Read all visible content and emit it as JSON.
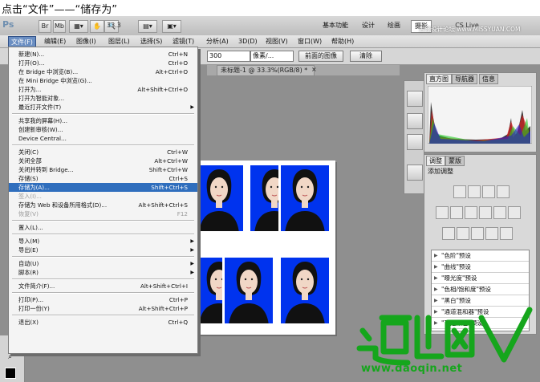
{
  "caption": "点击“文件”——“储存为”",
  "topbar": {
    "zoom": "33.3",
    "workspaces": [
      "基本功能",
      "设计",
      "绘画",
      "摄影"
    ],
    "cs_live": "CS Live",
    "overlay_text": "思缘设计论坛 www.MISSYUAN.COM"
  },
  "menubar": [
    "文件(F)",
    "编辑(E)",
    "图像(I)",
    "图层(L)",
    "选择(S)",
    "滤镜(T)",
    "分析(A)",
    "3D(D)",
    "视图(V)",
    "窗口(W)",
    "帮助(H)"
  ],
  "optbar": {
    "resolution_value": "300",
    "unit": "像素/...",
    "front_image_button": "前面的图像",
    "clear_button": "清除"
  },
  "tabs": {
    "doc_tab_label": "未标题-1 @ 33.3%(RGB/8) *"
  },
  "file_menu": [
    {
      "label": "新建(N)...",
      "shortcut": "Ctrl+N"
    },
    {
      "label": "打开(O)...",
      "shortcut": "Ctrl+O"
    },
    {
      "label": "在 Bridge 中浏览(B)...",
      "shortcut": "Alt+Ctrl+O"
    },
    {
      "label": "在 Mini Bridge 中浏览(G)...",
      "shortcut": ""
    },
    {
      "label": "打开为...",
      "shortcut": "Alt+Shift+Ctrl+O"
    },
    {
      "label": "打开为智能对象...",
      "shortcut": ""
    },
    {
      "label": "最近打开文件(T)",
      "shortcut": ""
    },
    {
      "label": "共享我的屏幕(H)...",
      "shortcut": ""
    },
    {
      "label": "创建新审核(W)...",
      "shortcut": ""
    },
    {
      "label": "Device Central...",
      "shortcut": ""
    },
    {
      "label": "关闭(C)",
      "shortcut": "Ctrl+W"
    },
    {
      "label": "关闭全部",
      "shortcut": "Alt+Ctrl+W"
    },
    {
      "label": "关闭并转到 Bridge...",
      "shortcut": "Shift+Ctrl+W"
    },
    {
      "label": "存储(S)",
      "shortcut": "Ctrl+S"
    },
    {
      "label": "存储为(A)...",
      "shortcut": "Shift+Ctrl+S"
    },
    {
      "label": "签入(I)...",
      "shortcut": ""
    },
    {
      "label": "存储为 Web 和设备所用格式(D)...",
      "shortcut": "Alt+Shift+Ctrl+S"
    },
    {
      "label": "恢复(V)",
      "shortcut": "F12"
    },
    {
      "label": "置入(L)...",
      "shortcut": ""
    },
    {
      "label": "导入(M)",
      "shortcut": ""
    },
    {
      "label": "导出(E)",
      "shortcut": ""
    },
    {
      "label": "自动(U)",
      "shortcut": ""
    },
    {
      "label": "脚本(R)",
      "shortcut": ""
    },
    {
      "label": "文件简介(F)...",
      "shortcut": "Alt+Shift+Ctrl+I"
    },
    {
      "label": "打印(P)...",
      "shortcut": "Ctrl+P"
    },
    {
      "label": "打印一份(Y)",
      "shortcut": "Alt+Shift+Ctrl+P"
    },
    {
      "label": "退出(X)",
      "shortcut": "Ctrl+Q"
    }
  ],
  "histogram_panel": {
    "tabs": [
      "直方图",
      "导航器",
      "信息"
    ]
  },
  "adjust_panel": {
    "tabs": [
      "调整",
      "蒙版"
    ],
    "title": "添加调整",
    "presets": [
      "\"色阶\"预设",
      "\"曲线\"预设",
      "\"曝光度\"预设",
      "\"色相/饱和度\"预设",
      "\"黑白\"预设",
      "\"通道混和器\"预设",
      "\"可选颜色\"预设"
    ]
  },
  "watermark": {
    "url": "www.daoqin.net"
  },
  "colors": {
    "menu_highlight": "#2f6ebd",
    "photo_bg": "#0033ee",
    "watermark_green": "#15a61c"
  }
}
